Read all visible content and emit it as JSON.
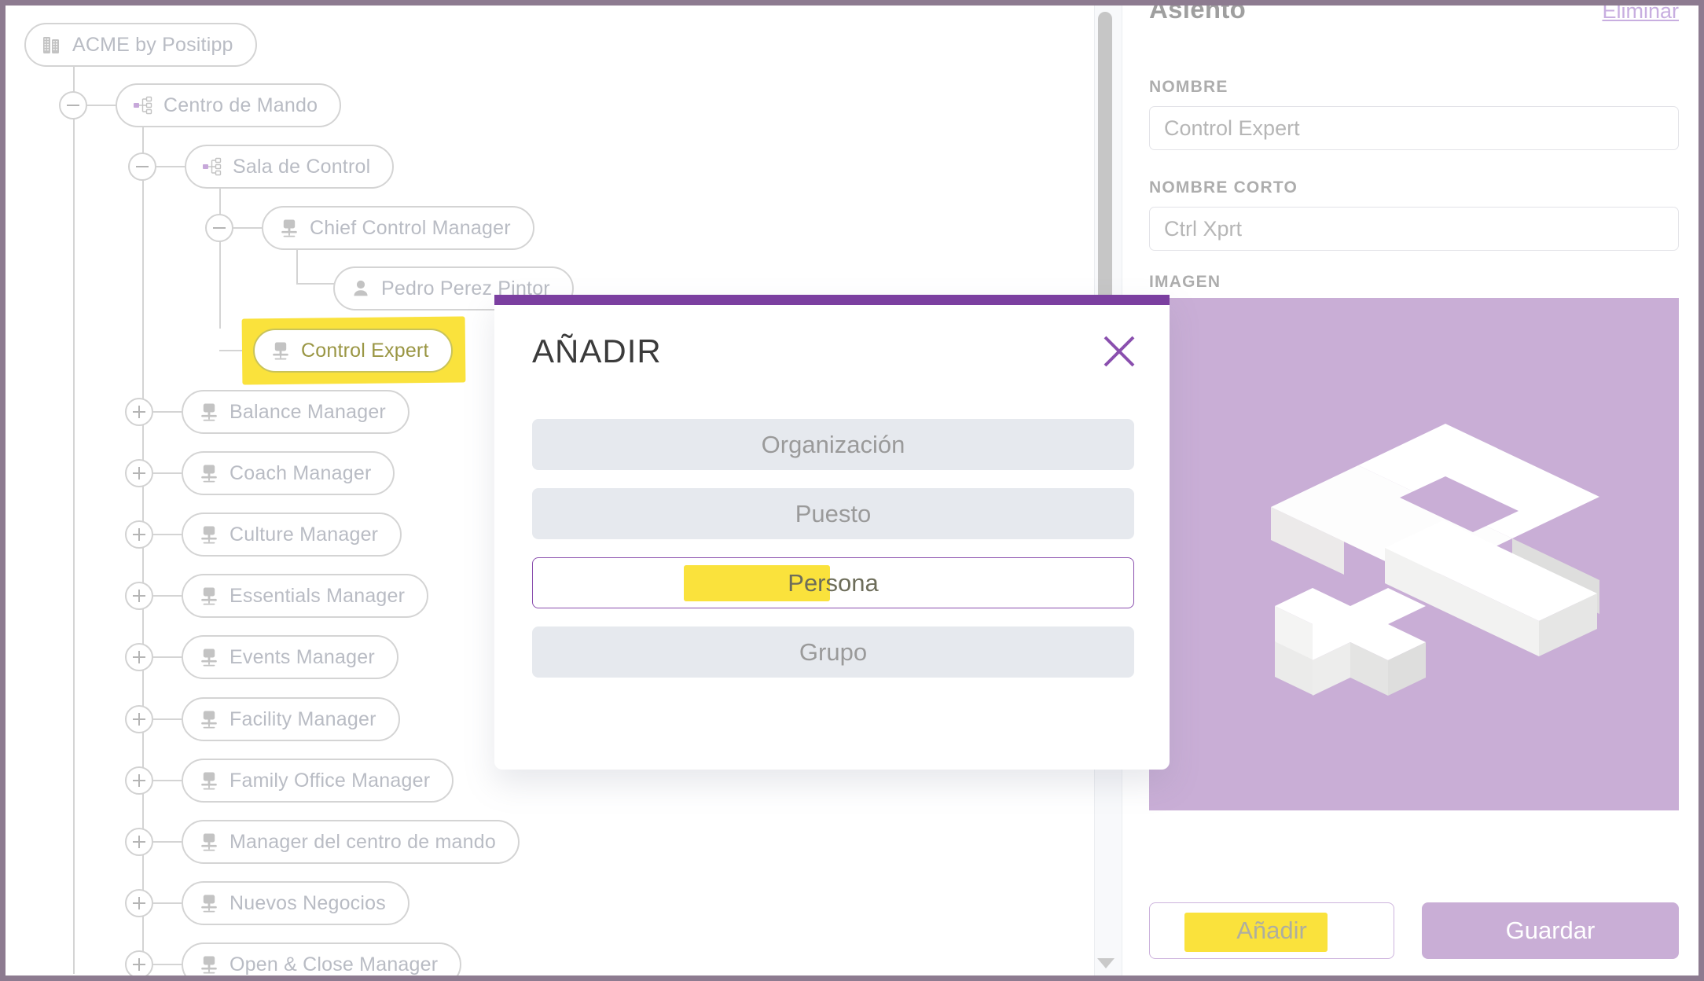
{
  "theme": {
    "frame_border": "#8d7b90",
    "accent_purple": "#7b3fa0",
    "accent_lilac": "#c9aed6",
    "highlighter_yellow": "#fae23c",
    "node_border": "#d4d4d4",
    "node_text": "#b9bcc4"
  },
  "tree": {
    "nodes": [
      {
        "label": "ACME by Positipp",
        "icon": "building-icon",
        "depth": 0,
        "toggle": "none",
        "highlighted": false
      },
      {
        "label": "Centro de Mando",
        "icon": "org-chart-icon",
        "depth": 1,
        "toggle": "collapse",
        "highlighted": false
      },
      {
        "label": "Sala de Control",
        "icon": "org-chart-icon",
        "depth": 2,
        "toggle": "collapse",
        "highlighted": false
      },
      {
        "label": "Chief Control Manager",
        "icon": "office-chair-icon",
        "depth": 3,
        "toggle": "collapse",
        "highlighted": false
      },
      {
        "label": "Pedro Perez Pintor",
        "icon": "person-icon",
        "depth": 4,
        "toggle": "none",
        "highlighted": false
      },
      {
        "label": "Control Expert",
        "icon": "office-chair-icon",
        "depth": 3,
        "toggle": "none",
        "highlighted": true
      },
      {
        "label": "Balance Manager",
        "icon": "office-chair-icon",
        "depth": 2,
        "toggle": "expand",
        "highlighted": false
      },
      {
        "label": "Coach Manager",
        "icon": "office-chair-icon",
        "depth": 2,
        "toggle": "expand",
        "highlighted": false
      },
      {
        "label": "Culture Manager",
        "icon": "office-chair-icon",
        "depth": 2,
        "toggle": "expand",
        "highlighted": false
      },
      {
        "label": "Essentials Manager",
        "icon": "office-chair-icon",
        "depth": 2,
        "toggle": "expand",
        "highlighted": false
      },
      {
        "label": "Events Manager",
        "icon": "office-chair-icon",
        "depth": 2,
        "toggle": "expand",
        "highlighted": false
      },
      {
        "label": "Facility Manager",
        "icon": "office-chair-icon",
        "depth": 2,
        "toggle": "expand",
        "highlighted": false
      },
      {
        "label": "Family Office Manager",
        "icon": "office-chair-icon",
        "depth": 2,
        "toggle": "expand",
        "highlighted": false
      },
      {
        "label": "Manager del centro de mando",
        "icon": "office-chair-icon",
        "depth": 2,
        "toggle": "expand",
        "highlighted": false
      },
      {
        "label": "Nuevos Negocios",
        "icon": "office-chair-icon",
        "depth": 2,
        "toggle": "expand",
        "highlighted": false
      },
      {
        "label": "Open & Close Manager",
        "icon": "office-chair-icon",
        "depth": 2,
        "toggle": "expand",
        "highlighted": false
      }
    ]
  },
  "detail": {
    "title": "Asiento",
    "delete_link": "Eliminar",
    "fields": [
      {
        "label": "NOMBRE",
        "value": "Control Expert",
        "placeholder": "Control Expert"
      },
      {
        "label": "NOMBRE CORTO",
        "value": "Ctrl Xprt",
        "placeholder": "Ctrl Xprt"
      }
    ],
    "image_label": "IMAGEN",
    "image_alt": "positipp-isometric-logo",
    "buttons": {
      "add": "Añadir",
      "save": "Guardar"
    }
  },
  "modal": {
    "title": "AÑADIR",
    "close_icon": "close-icon",
    "options": [
      {
        "label": "Organización",
        "selected": false,
        "highlighted": false
      },
      {
        "label": "Puesto",
        "selected": false,
        "highlighted": false
      },
      {
        "label": "Persona",
        "selected": true,
        "highlighted": true
      },
      {
        "label": "Grupo",
        "selected": false,
        "highlighted": false
      }
    ]
  },
  "scrollbar": {
    "orientation": "vertical",
    "down_arrow_icon": "chevron-down-icon"
  }
}
